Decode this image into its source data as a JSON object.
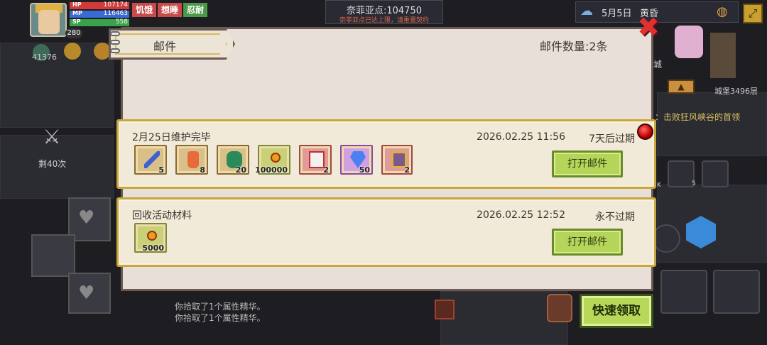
{
  "hud": {
    "level": "280",
    "hp_label": "HP",
    "hp_value": "107174",
    "mp_label": "MP",
    "mp_value": "116463",
    "sp_label": "SP",
    "sp_value": "558",
    "status": [
      "饥饿",
      "想睡",
      "忍耐"
    ],
    "gold": "41376",
    "remaining": "剩40次"
  },
  "top": {
    "points": "奈菲亚点:104750",
    "points_note": "奈菲亚点已达上限，请重置契约",
    "date": "5月5日",
    "time_of_day": "黄昏"
  },
  "right_hud": {
    "town": "城",
    "castle_floor": "城堡3496层",
    "quest": "：击败狂风峡谷的首领",
    "item_count_k": "K",
    "item_count_5": "5"
  },
  "mail_dialog": {
    "tab_title": "邮件",
    "count_label": "邮件数量:2条",
    "mails": [
      {
        "title": "2月25日维护完毕",
        "datetime": "2026.02.25 11:56",
        "expiry": "7天后过期",
        "open_label": "打开邮件",
        "items": [
          {
            "name": "staff-icon",
            "qty": "5",
            "color": "#d8c088"
          },
          {
            "name": "potion-icon",
            "qty": "8",
            "color": "#d8c088"
          },
          {
            "name": "cannon-icon",
            "qty": "20",
            "color": "#d8c088"
          },
          {
            "name": "coin-icon",
            "qty": "100000",
            "color": "#c8d078"
          },
          {
            "name": "card-icon",
            "qty": "2",
            "color": "#e09a9a"
          },
          {
            "name": "diamond-icon",
            "qty": "50",
            "color": "#d0a0e0"
          },
          {
            "name": "portrait-icon",
            "qty": "2",
            "color": "#e09a9a"
          }
        ]
      },
      {
        "title": "回收活动材料",
        "datetime": "2026.02.25 12:52",
        "expiry": "永不过期",
        "open_label": "打开邮件",
        "items": [
          {
            "name": "coin-icon",
            "qty": "5000",
            "color": "#c8d078"
          }
        ]
      }
    ],
    "quick_claim": "快速领取"
  },
  "log": [
    "你拾取了1个属性精华。",
    "你拾取了1个属性精华。"
  ]
}
